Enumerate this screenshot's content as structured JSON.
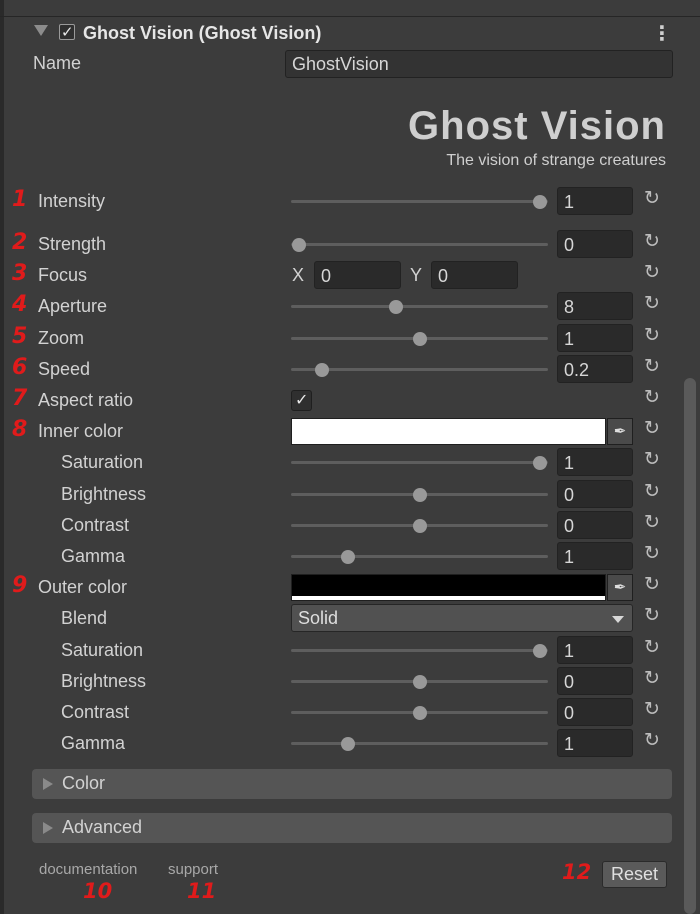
{
  "header": {
    "title": "Ghost Vision (Ghost Vision)",
    "enabled": true,
    "menu_icon": "kebab-icon"
  },
  "name_field": {
    "label": "Name",
    "value": "GhostVision"
  },
  "brand": {
    "title": "Ghost Vision",
    "tagline": "The vision of strange creatures"
  },
  "properties": [
    {
      "id": "intensity",
      "num": "1",
      "label": "Intensity",
      "type": "slider",
      "value": "1",
      "fraction": 0.97
    },
    {
      "id": "strength",
      "num": "2",
      "label": "Strength",
      "type": "slider",
      "value": "0",
      "fraction": 0.03
    },
    {
      "id": "focus",
      "num": "3",
      "label": "Focus",
      "type": "vector2",
      "x_label": "X",
      "x": "0",
      "y_label": "Y",
      "y": "0"
    },
    {
      "id": "aperture",
      "num": "4",
      "label": "Aperture",
      "type": "slider",
      "value": "8",
      "fraction": 0.41
    },
    {
      "id": "zoom",
      "num": "5",
      "label": "Zoom",
      "type": "slider",
      "value": "1",
      "fraction": 0.5
    },
    {
      "id": "speed",
      "num": "6",
      "label": "Speed",
      "type": "slider",
      "value": "0.2",
      "fraction": 0.12
    },
    {
      "id": "aspect",
      "num": "7",
      "label": "Aspect ratio",
      "type": "checkbox",
      "checked": true
    },
    {
      "id": "inner_color",
      "num": "8",
      "label": "Inner color",
      "type": "color",
      "color": "#ffffff"
    },
    {
      "id": "inner_saturation",
      "label": "Saturation",
      "type": "slider",
      "value": "1",
      "fraction": 0.97,
      "indent": true
    },
    {
      "id": "inner_brightness",
      "label": "Brightness",
      "type": "slider",
      "value": "0",
      "fraction": 0.5,
      "indent": true
    },
    {
      "id": "inner_contrast",
      "label": "Contrast",
      "type": "slider",
      "value": "0",
      "fraction": 0.5,
      "indent": true
    },
    {
      "id": "inner_gamma",
      "label": "Gamma",
      "type": "slider",
      "value": "1",
      "fraction": 0.22,
      "indent": true
    },
    {
      "id": "outer_color",
      "num": "9",
      "label": "Outer color",
      "type": "color",
      "color": "#000000"
    },
    {
      "id": "blend",
      "label": "Blend",
      "type": "dropdown",
      "value": "Solid",
      "indent": true
    },
    {
      "id": "outer_saturation",
      "label": "Saturation",
      "type": "slider",
      "value": "1",
      "fraction": 0.97,
      "indent": true
    },
    {
      "id": "outer_brightness",
      "label": "Brightness",
      "type": "slider",
      "value": "0",
      "fraction": 0.5,
      "indent": true
    },
    {
      "id": "outer_contrast",
      "label": "Contrast",
      "type": "slider",
      "value": "0",
      "fraction": 0.5,
      "indent": true
    },
    {
      "id": "outer_gamma",
      "label": "Gamma",
      "type": "slider",
      "value": "1",
      "fraction": 0.22,
      "indent": true
    }
  ],
  "sections": [
    {
      "id": "color",
      "label": "Color"
    },
    {
      "id": "advanced",
      "label": "Advanced"
    }
  ],
  "footer": {
    "documentation": "documentation",
    "documentation_num": "10",
    "support": "support",
    "support_num": "11",
    "reset_num": "12",
    "reset_label": "Reset"
  },
  "colors": {
    "annotation": "#e01b1b",
    "background": "#3c3c3c",
    "field": "#2a2a2a"
  }
}
